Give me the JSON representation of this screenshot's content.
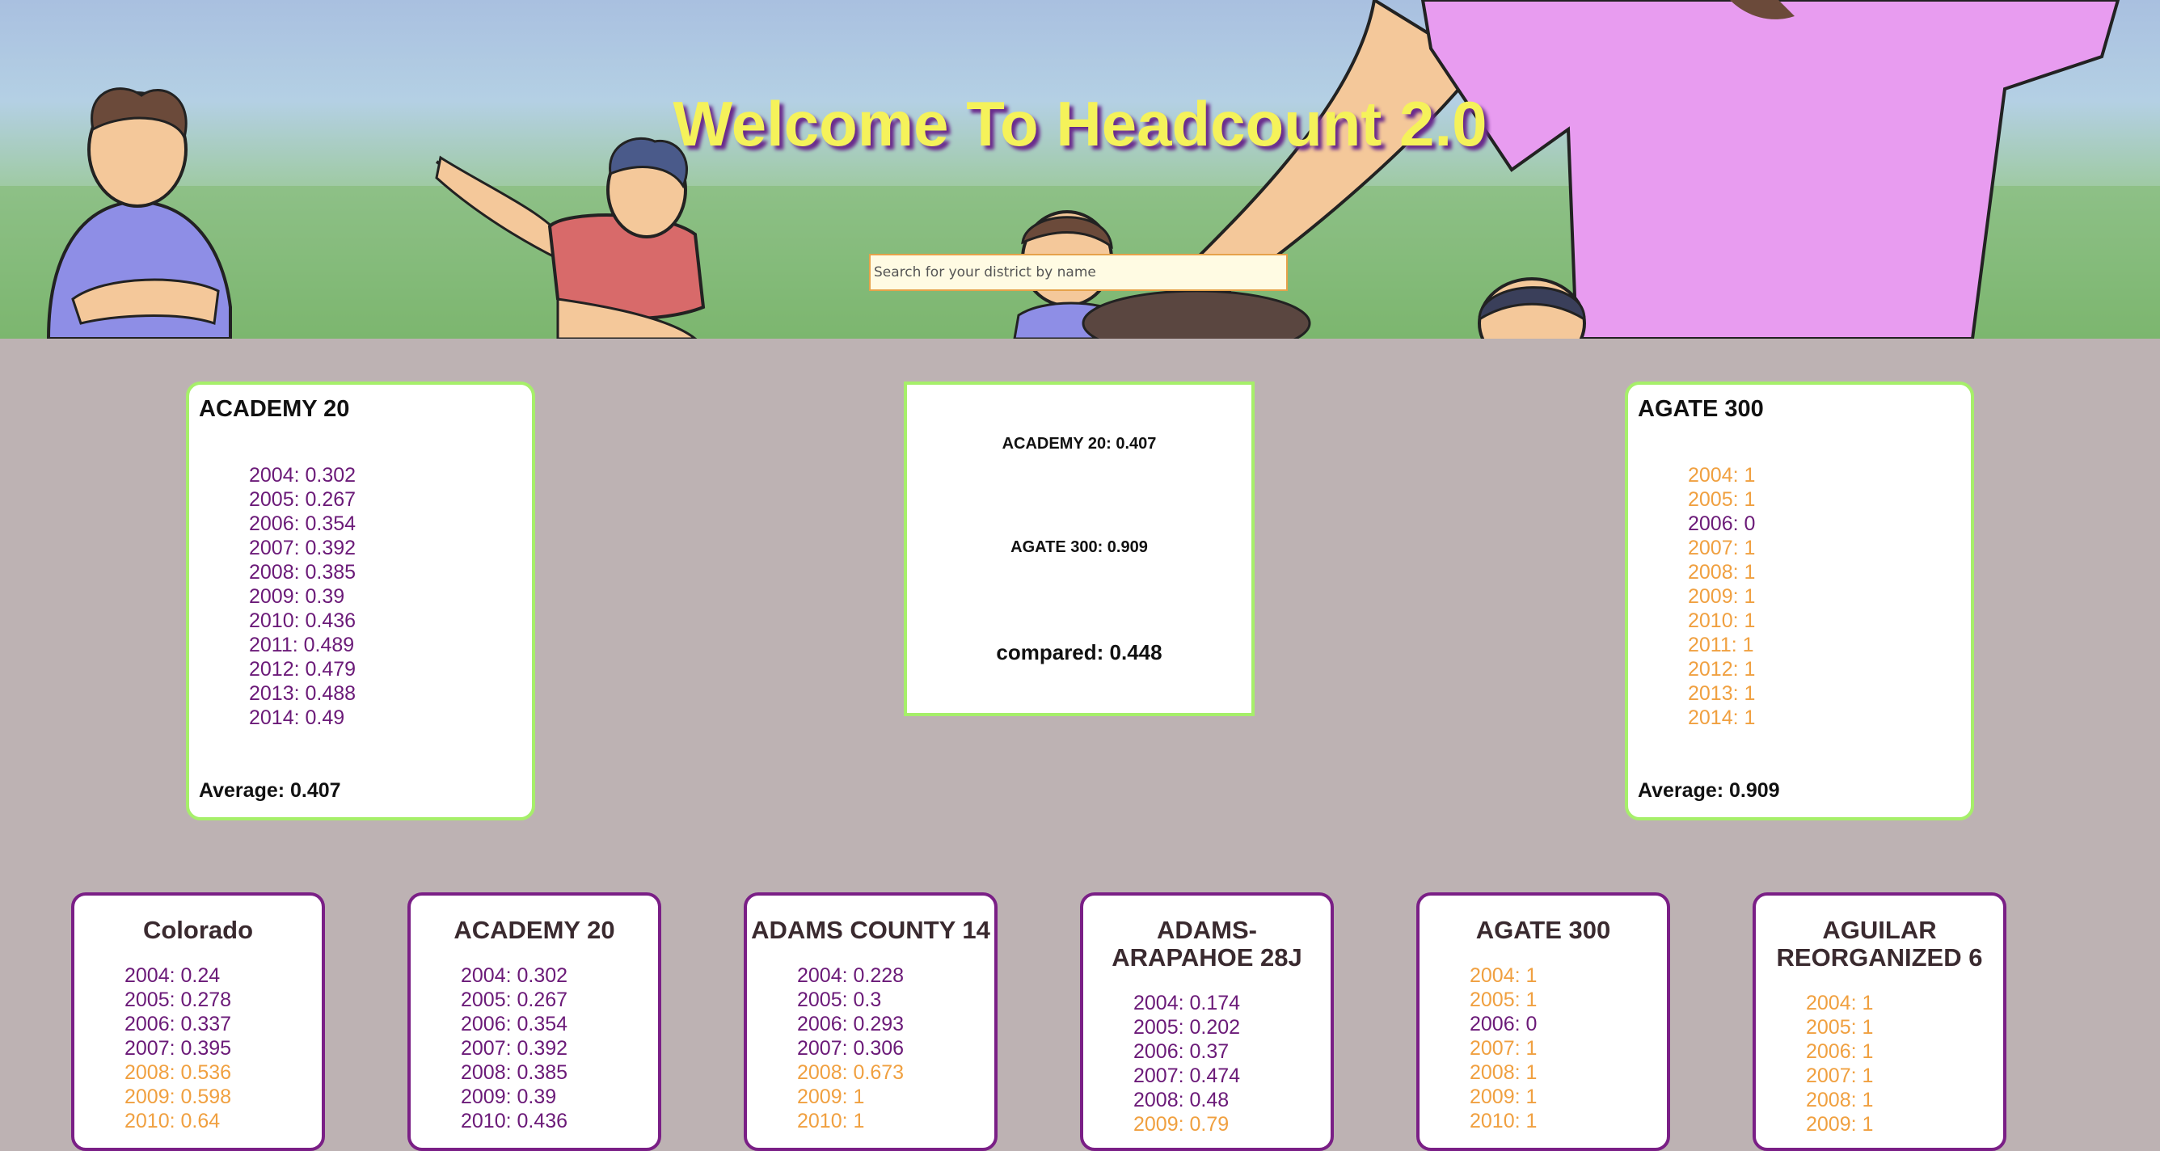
{
  "header": {
    "title": "Welcome To Headcount 2.0",
    "search_placeholder": "Search for your district by name"
  },
  "colors": {
    "high": "#f0a040",
    "low": "#6b1a78",
    "selected_border": "#a6ef6a",
    "card_border": "#7a1f86"
  },
  "selected": [
    {
      "name": "ACADEMY 20",
      "rows": [
        {
          "text": "2004: 0.302",
          "level": "low"
        },
        {
          "text": "2005: 0.267",
          "level": "low"
        },
        {
          "text": "2006: 0.354",
          "level": "low"
        },
        {
          "text": "2007: 0.392",
          "level": "low"
        },
        {
          "text": "2008: 0.385",
          "level": "low"
        },
        {
          "text": "2009: 0.39",
          "level": "low"
        },
        {
          "text": "2010: 0.436",
          "level": "low"
        },
        {
          "text": "2011: 0.489",
          "level": "low"
        },
        {
          "text": "2012: 0.479",
          "level": "low"
        },
        {
          "text": "2013: 0.488",
          "level": "low"
        },
        {
          "text": "2014: 0.49",
          "level": "low"
        }
      ],
      "average": "Average: 0.407"
    },
    {
      "name": "AGATE 300",
      "rows": [
        {
          "text": "2004: 1",
          "level": "high"
        },
        {
          "text": "2005: 1",
          "level": "high"
        },
        {
          "text": "2006: 0",
          "level": "low"
        },
        {
          "text": "2007: 1",
          "level": "high"
        },
        {
          "text": "2008: 1",
          "level": "high"
        },
        {
          "text": "2009: 1",
          "level": "high"
        },
        {
          "text": "2010: 1",
          "level": "high"
        },
        {
          "text": "2011: 1",
          "level": "high"
        },
        {
          "text": "2012: 1",
          "level": "high"
        },
        {
          "text": "2013: 1",
          "level": "high"
        },
        {
          "text": "2014: 1",
          "level": "high"
        }
      ],
      "average": "Average: 0.909"
    }
  ],
  "comparison": {
    "first": "ACADEMY 20: 0.407",
    "second": "AGATE 300: 0.909",
    "compared": "compared: 0.448"
  },
  "districts": [
    {
      "name": "Colorado",
      "rows": [
        {
          "text": "2004: 0.24",
          "level": "low"
        },
        {
          "text": "2005: 0.278",
          "level": "low"
        },
        {
          "text": "2006: 0.337",
          "level": "low"
        },
        {
          "text": "2007: 0.395",
          "level": "low"
        },
        {
          "text": "2008: 0.536",
          "level": "high"
        },
        {
          "text": "2009: 0.598",
          "level": "high"
        },
        {
          "text": "2010: 0.64",
          "level": "high"
        }
      ]
    },
    {
      "name": "ACADEMY 20",
      "rows": [
        {
          "text": "2004: 0.302",
          "level": "low"
        },
        {
          "text": "2005: 0.267",
          "level": "low"
        },
        {
          "text": "2006: 0.354",
          "level": "low"
        },
        {
          "text": "2007: 0.392",
          "level": "low"
        },
        {
          "text": "2008: 0.385",
          "level": "low"
        },
        {
          "text": "2009: 0.39",
          "level": "low"
        },
        {
          "text": "2010: 0.436",
          "level": "low"
        }
      ]
    },
    {
      "name": "ADAMS COUNTY 14",
      "rows": [
        {
          "text": "2004: 0.228",
          "level": "low"
        },
        {
          "text": "2005: 0.3",
          "level": "low"
        },
        {
          "text": "2006: 0.293",
          "level": "low"
        },
        {
          "text": "2007: 0.306",
          "level": "low"
        },
        {
          "text": "2008: 0.673",
          "level": "high"
        },
        {
          "text": "2009: 1",
          "level": "high"
        },
        {
          "text": "2010: 1",
          "level": "high"
        }
      ]
    },
    {
      "name": "ADAMS-ARAPAHOE 28J",
      "rows": [
        {
          "text": "2004: 0.174",
          "level": "low"
        },
        {
          "text": "2005: 0.202",
          "level": "low"
        },
        {
          "text": "2006: 0.37",
          "level": "low"
        },
        {
          "text": "2007: 0.474",
          "level": "low"
        },
        {
          "text": "2008: 0.48",
          "level": "low"
        },
        {
          "text": "2009: 0.79",
          "level": "high"
        }
      ]
    },
    {
      "name": "AGATE 300",
      "rows": [
        {
          "text": "2004: 1",
          "level": "high"
        },
        {
          "text": "2005: 1",
          "level": "high"
        },
        {
          "text": "2006: 0",
          "level": "low"
        },
        {
          "text": "2007: 1",
          "level": "high"
        },
        {
          "text": "2008: 1",
          "level": "high"
        },
        {
          "text": "2009: 1",
          "level": "high"
        },
        {
          "text": "2010: 1",
          "level": "high"
        }
      ]
    },
    {
      "name": "AGUILAR REORGANIZED 6",
      "rows": [
        {
          "text": "2004: 1",
          "level": "high"
        },
        {
          "text": "2005: 1",
          "level": "high"
        },
        {
          "text": "2006: 1",
          "level": "high"
        },
        {
          "text": "2007: 1",
          "level": "high"
        },
        {
          "text": "2008: 1",
          "level": "high"
        },
        {
          "text": "2009: 1",
          "level": "high"
        }
      ]
    }
  ]
}
